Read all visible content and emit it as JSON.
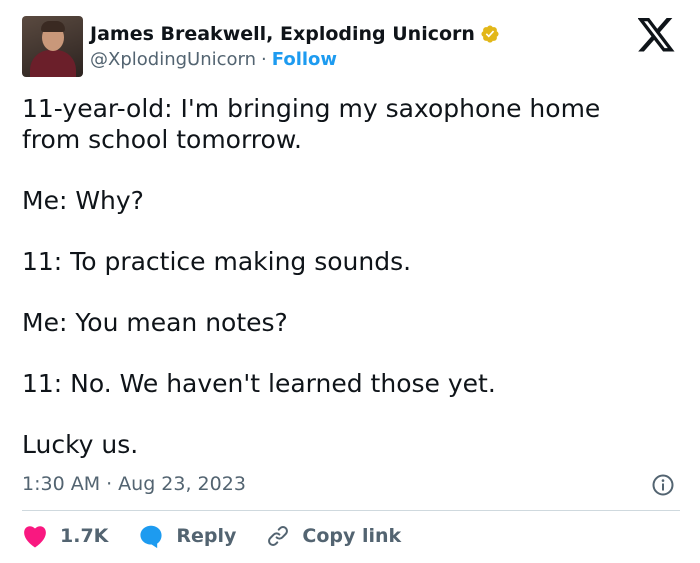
{
  "author": {
    "name": "James Breakwell, Exploding Unicorn",
    "handle": "@XplodingUnicorn",
    "separator": "·",
    "follow_label": "Follow"
  },
  "tweet": {
    "lines": [
      "11-year-old: I'm bringing my saxophone home",
      "from school tomorrow.",
      "Me: Why?",
      "11: To practice making sounds.",
      "Me: You mean notes?",
      "11: No. We haven't learned those yet.",
      "Lucky us."
    ]
  },
  "meta": {
    "time": "1:30 AM",
    "separator": "·",
    "date": "Aug 23, 2023"
  },
  "actions": {
    "likes_count": "1.7K",
    "reply_label": "Reply",
    "copy_link_label": "Copy link"
  },
  "colors": {
    "like": "#f91880",
    "reply": "#1d9bf0",
    "follow": "#1d9bf0",
    "verified": "#e2b719",
    "secondary_text": "#536471"
  },
  "icons": {
    "logo": "x-logo-icon",
    "verified": "verified-badge-icon",
    "info": "info-icon",
    "like": "heart-icon",
    "reply": "speech-bubble-icon",
    "copy_link": "link-icon"
  }
}
